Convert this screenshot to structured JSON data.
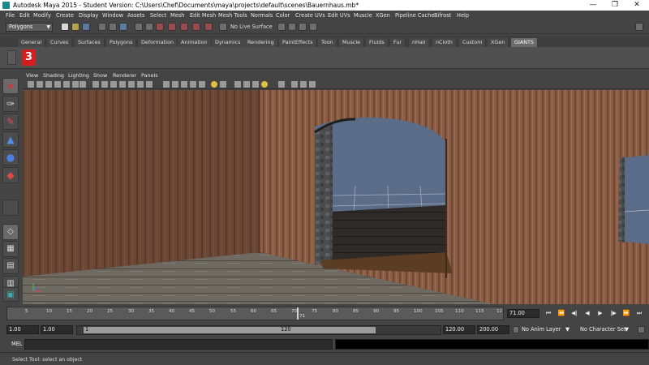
{
  "window": {
    "title": "Autodesk Maya 2015 - Student Version: C:\\Users\\Chef\\Documents\\maya\\projects\\default\\scenes\\Bauernhaus.mb*",
    "minimize": "—",
    "restore": "❐",
    "close": "✕"
  },
  "menubar": [
    "File",
    "Edit",
    "Modify",
    "Create",
    "Display",
    "Window",
    "Assets",
    "Select",
    "Mesh",
    "Edit Mesh",
    "Mesh Tools",
    "Normals",
    "Color",
    "Create UVs",
    "Edit UVs",
    "Muscle",
    "XGen",
    "Pipeline Cache",
    "Bifrost",
    "Help"
  ],
  "statusline": {
    "mode": "Polygons",
    "live_surface": "No Live Surface"
  },
  "shelf": {
    "tabs": [
      "General",
      "Curves",
      "Surfaces",
      "Polygons",
      "Deformation",
      "Animation",
      "Dynamics",
      "Rendering",
      "PaintEffects",
      "Toon",
      "Muscle",
      "Fluids",
      "Fur",
      "nHair",
      "nCloth",
      "Custom",
      "XGen",
      "GIANTS"
    ],
    "active_tab": "GIANTS",
    "logo": "3"
  },
  "panel_menu": [
    "View",
    "Shading",
    "Lighting",
    "Show",
    "Renderer",
    "Panels"
  ],
  "timeline": {
    "ticks": [
      "5",
      "10",
      "15",
      "20",
      "25",
      "30",
      "35",
      "40",
      "45",
      "50",
      "55",
      "60",
      "65",
      "70",
      "75",
      "80",
      "85",
      "90",
      "95",
      "100",
      "105",
      "110",
      "115",
      "12"
    ],
    "current_frame_label": "71",
    "current_frame_field": "71.00"
  },
  "playback": [
    "⏮",
    "⏪",
    "◀|",
    "◀",
    "▶",
    "|▶",
    "⏩",
    "⏭"
  ],
  "range": {
    "start": "1.00",
    "playback_start": "1.00",
    "slider_start": "1",
    "slider_end": "120",
    "playback_end": "120.00",
    "end": "200.00",
    "anim_layer": "No Anim Layer",
    "character_set": "No Character Set"
  },
  "command_line": {
    "label": "MEL"
  },
  "help_line": "Select Tool: select an object",
  "colors": {
    "ui_bg": "#444444",
    "wall_wood": "#7a5440",
    "floor_wood": "#6e6a62",
    "sky": "#5a6c87",
    "logo_red": "#d21e1e"
  },
  "icons": {
    "select_tool": "arrow-cursor-icon",
    "lasso_tool": "lasso-icon",
    "paint_select": "paint-brush-icon",
    "move_tool": "move-arrows-icon",
    "sphere": "sphere-icon",
    "scale": "scale-icon"
  }
}
